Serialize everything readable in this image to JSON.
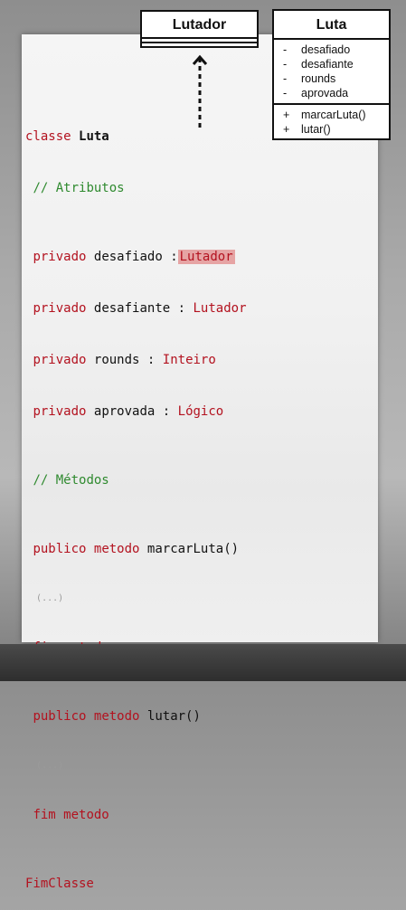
{
  "uml": {
    "lutador_box": {
      "title": "Lutador"
    },
    "luta_box": {
      "title": "Luta",
      "attributes": [
        {
          "symbol": "-",
          "name": "desafiado"
        },
        {
          "symbol": "-",
          "name": "desafiante"
        },
        {
          "symbol": "-",
          "name": "rounds"
        },
        {
          "symbol": "-",
          "name": "aprovada"
        }
      ],
      "methods": [
        {
          "symbol": "+",
          "name": "marcarLuta()"
        },
        {
          "symbol": "+",
          "name": "lutar()"
        }
      ]
    }
  },
  "code": {
    "class_keyword": "classe",
    "class_name": "Luta",
    "comment_attributes": "// Atributos",
    "attributes": [
      {
        "modifier": "privado",
        "name": "desafiado",
        "colon": ":",
        "type": "Lutador"
      },
      {
        "modifier": "privado",
        "name": "desafiante",
        "colon": ":",
        "type": "Lutador"
      },
      {
        "modifier": "privado",
        "name": "rounds",
        "colon": ":",
        "type": "Inteiro"
      },
      {
        "modifier": "privado",
        "name": "aprovada",
        "colon": ":",
        "type": "Lógico"
      }
    ],
    "comment_methods": "// Métodos",
    "methods": [
      {
        "modifier": "publico",
        "keyword": "metodo",
        "name": "marcarLuta()",
        "ellipsis": "(...)",
        "end": "fim metodo"
      },
      {
        "modifier": "publico",
        "keyword": "metodo",
        "name": "lutar()",
        "ellipsis": "(...)",
        "end": "fim metodo"
      }
    ],
    "end_class": "FimClasse"
  },
  "colors": {
    "keyword": "#b3121f",
    "comment": "#2f8a2f",
    "highlight": "#e6a4a4"
  }
}
